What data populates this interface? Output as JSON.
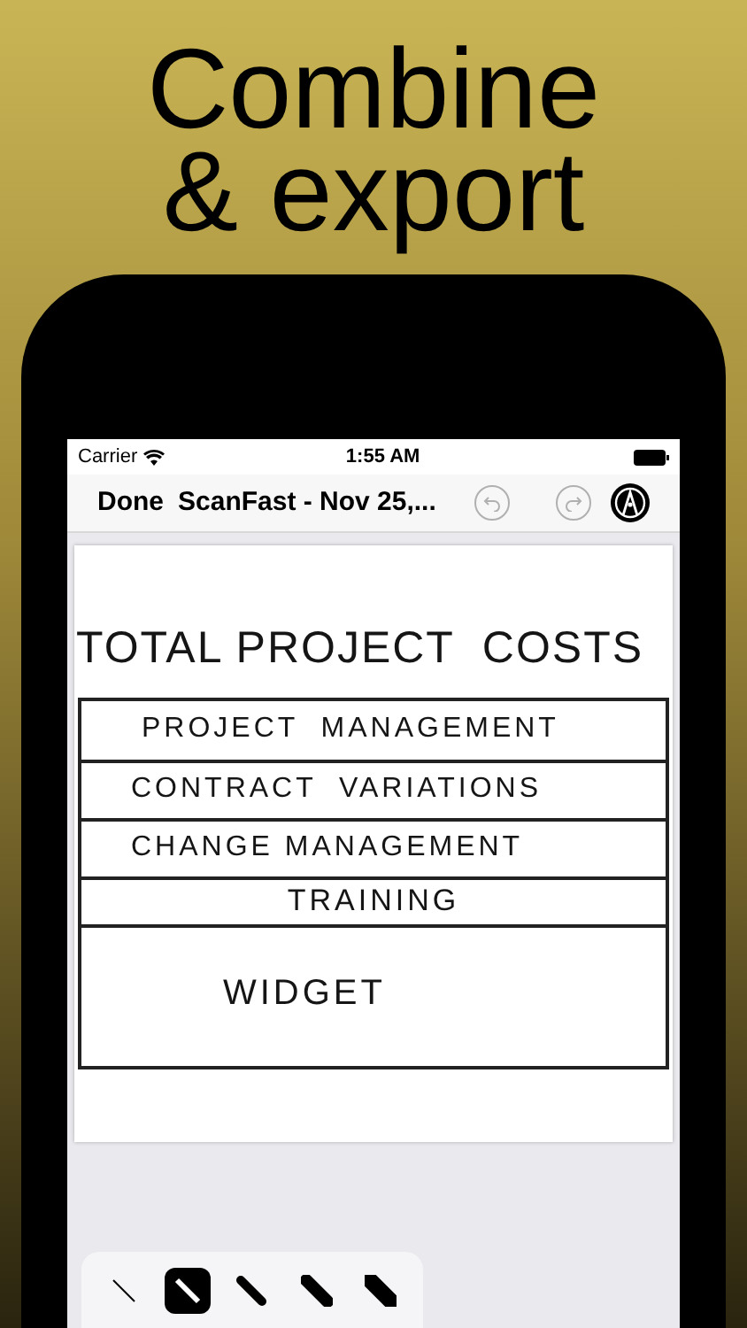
{
  "headline": [
    "Combine",
    "& export"
  ],
  "status_bar": {
    "carrier": "Carrier",
    "time": "1:55 AM"
  },
  "nav": {
    "done": "Done",
    "title": "ScanFast - Nov 25,...",
    "undo_disabled": true,
    "redo_disabled": true
  },
  "document": {
    "title": "TOTAL PROJECT  COSTS",
    "rows": [
      {
        "text": "PROJECT  MANAGEMENT",
        "kind": "left"
      },
      {
        "text": "CONTRACT  VARIATIONS",
        "kind": "left"
      },
      {
        "text": "CHANGE MANAGEMENT",
        "kind": "left"
      },
      {
        "text": "TRAINING",
        "kind": "center"
      },
      {
        "text": "WIDGET",
        "kind": "tall"
      }
    ]
  },
  "pens": [
    {
      "kind": "hairline",
      "selected": false
    },
    {
      "kind": "thin",
      "selected": true
    },
    {
      "kind": "medium",
      "selected": false
    },
    {
      "kind": "thick",
      "selected": false
    },
    {
      "kind": "heavy",
      "selected": false
    }
  ]
}
